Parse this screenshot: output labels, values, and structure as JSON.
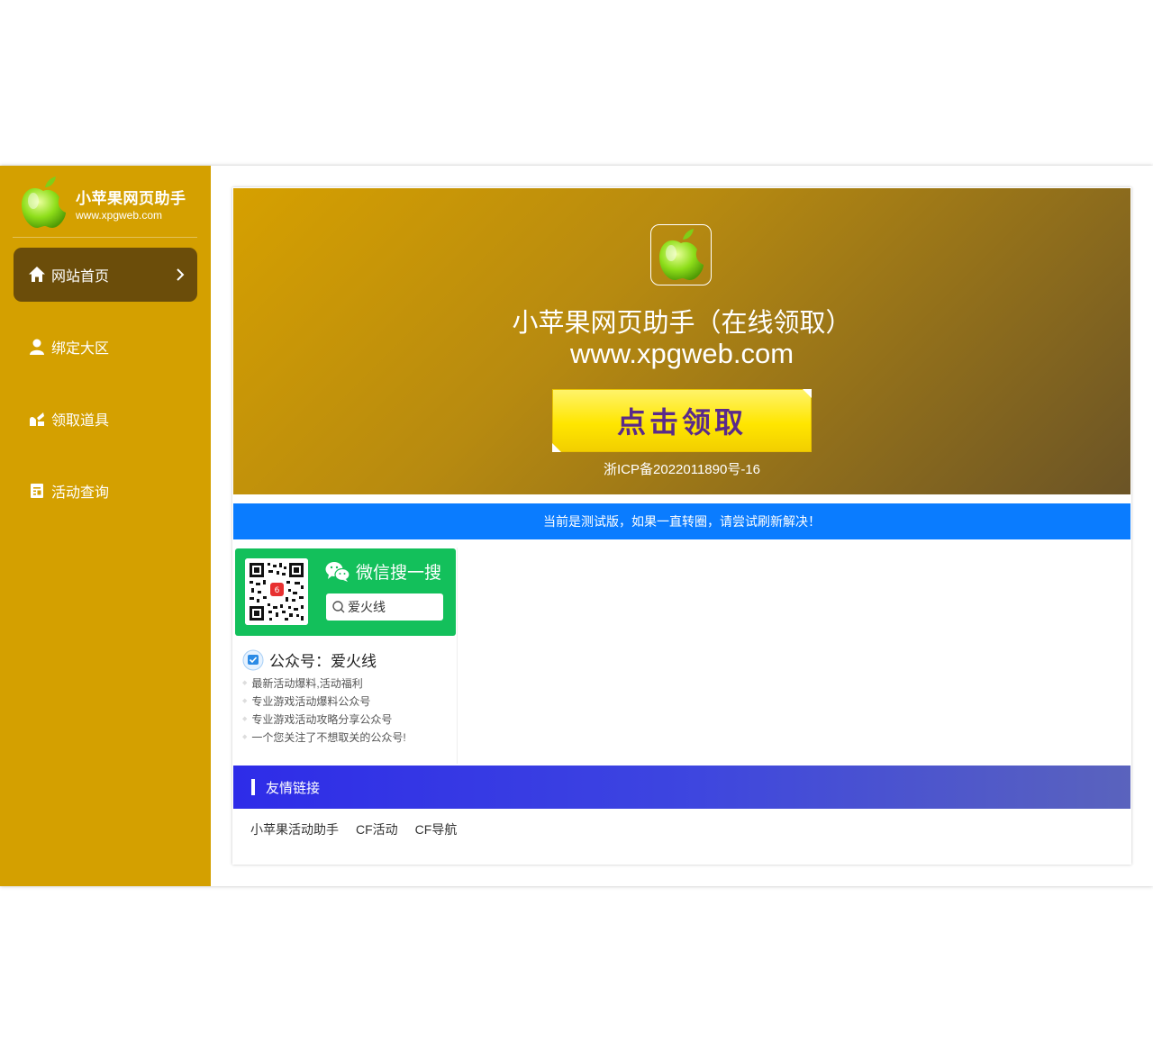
{
  "brand": {
    "name": "小苹果网页助手",
    "url": "www.xpgweb.com"
  },
  "nav": [
    {
      "label": "网站首页",
      "icon": "home-icon",
      "active": true
    },
    {
      "label": "绑定大区",
      "icon": "user-icon",
      "active": false
    },
    {
      "label": "领取道具",
      "icon": "gift-icon",
      "active": false
    },
    {
      "label": "活动查询",
      "icon": "document-icon",
      "active": false
    }
  ],
  "hero": {
    "title": "小苹果网页助手（在线领取）",
    "url": "www.xpgweb.com",
    "button": "点击领取",
    "icp": "浙ICP备2022011890号-16"
  },
  "notice": "当前是测试版，如果一直转圈，请尝试刷新解决！",
  "wechat": {
    "search_label": "微信搜一搜",
    "search_query": "爱火线",
    "account": "公众号：爱火线",
    "features": [
      "最新活动爆料,活动福利",
      "专业游戏活动爆料公众号",
      "专业游戏活动攻略分享公众号",
      "一个您关注了不想取关的公众号!"
    ]
  },
  "links": {
    "title": "友情链接",
    "items": [
      "小苹果活动助手",
      "CF活动",
      "CF导航"
    ]
  },
  "colors": {
    "sidebar": "#d4a000",
    "active_nav": "#6b4d0a",
    "notice": "#0a7cff",
    "wechat_green": "#13c05b"
  }
}
